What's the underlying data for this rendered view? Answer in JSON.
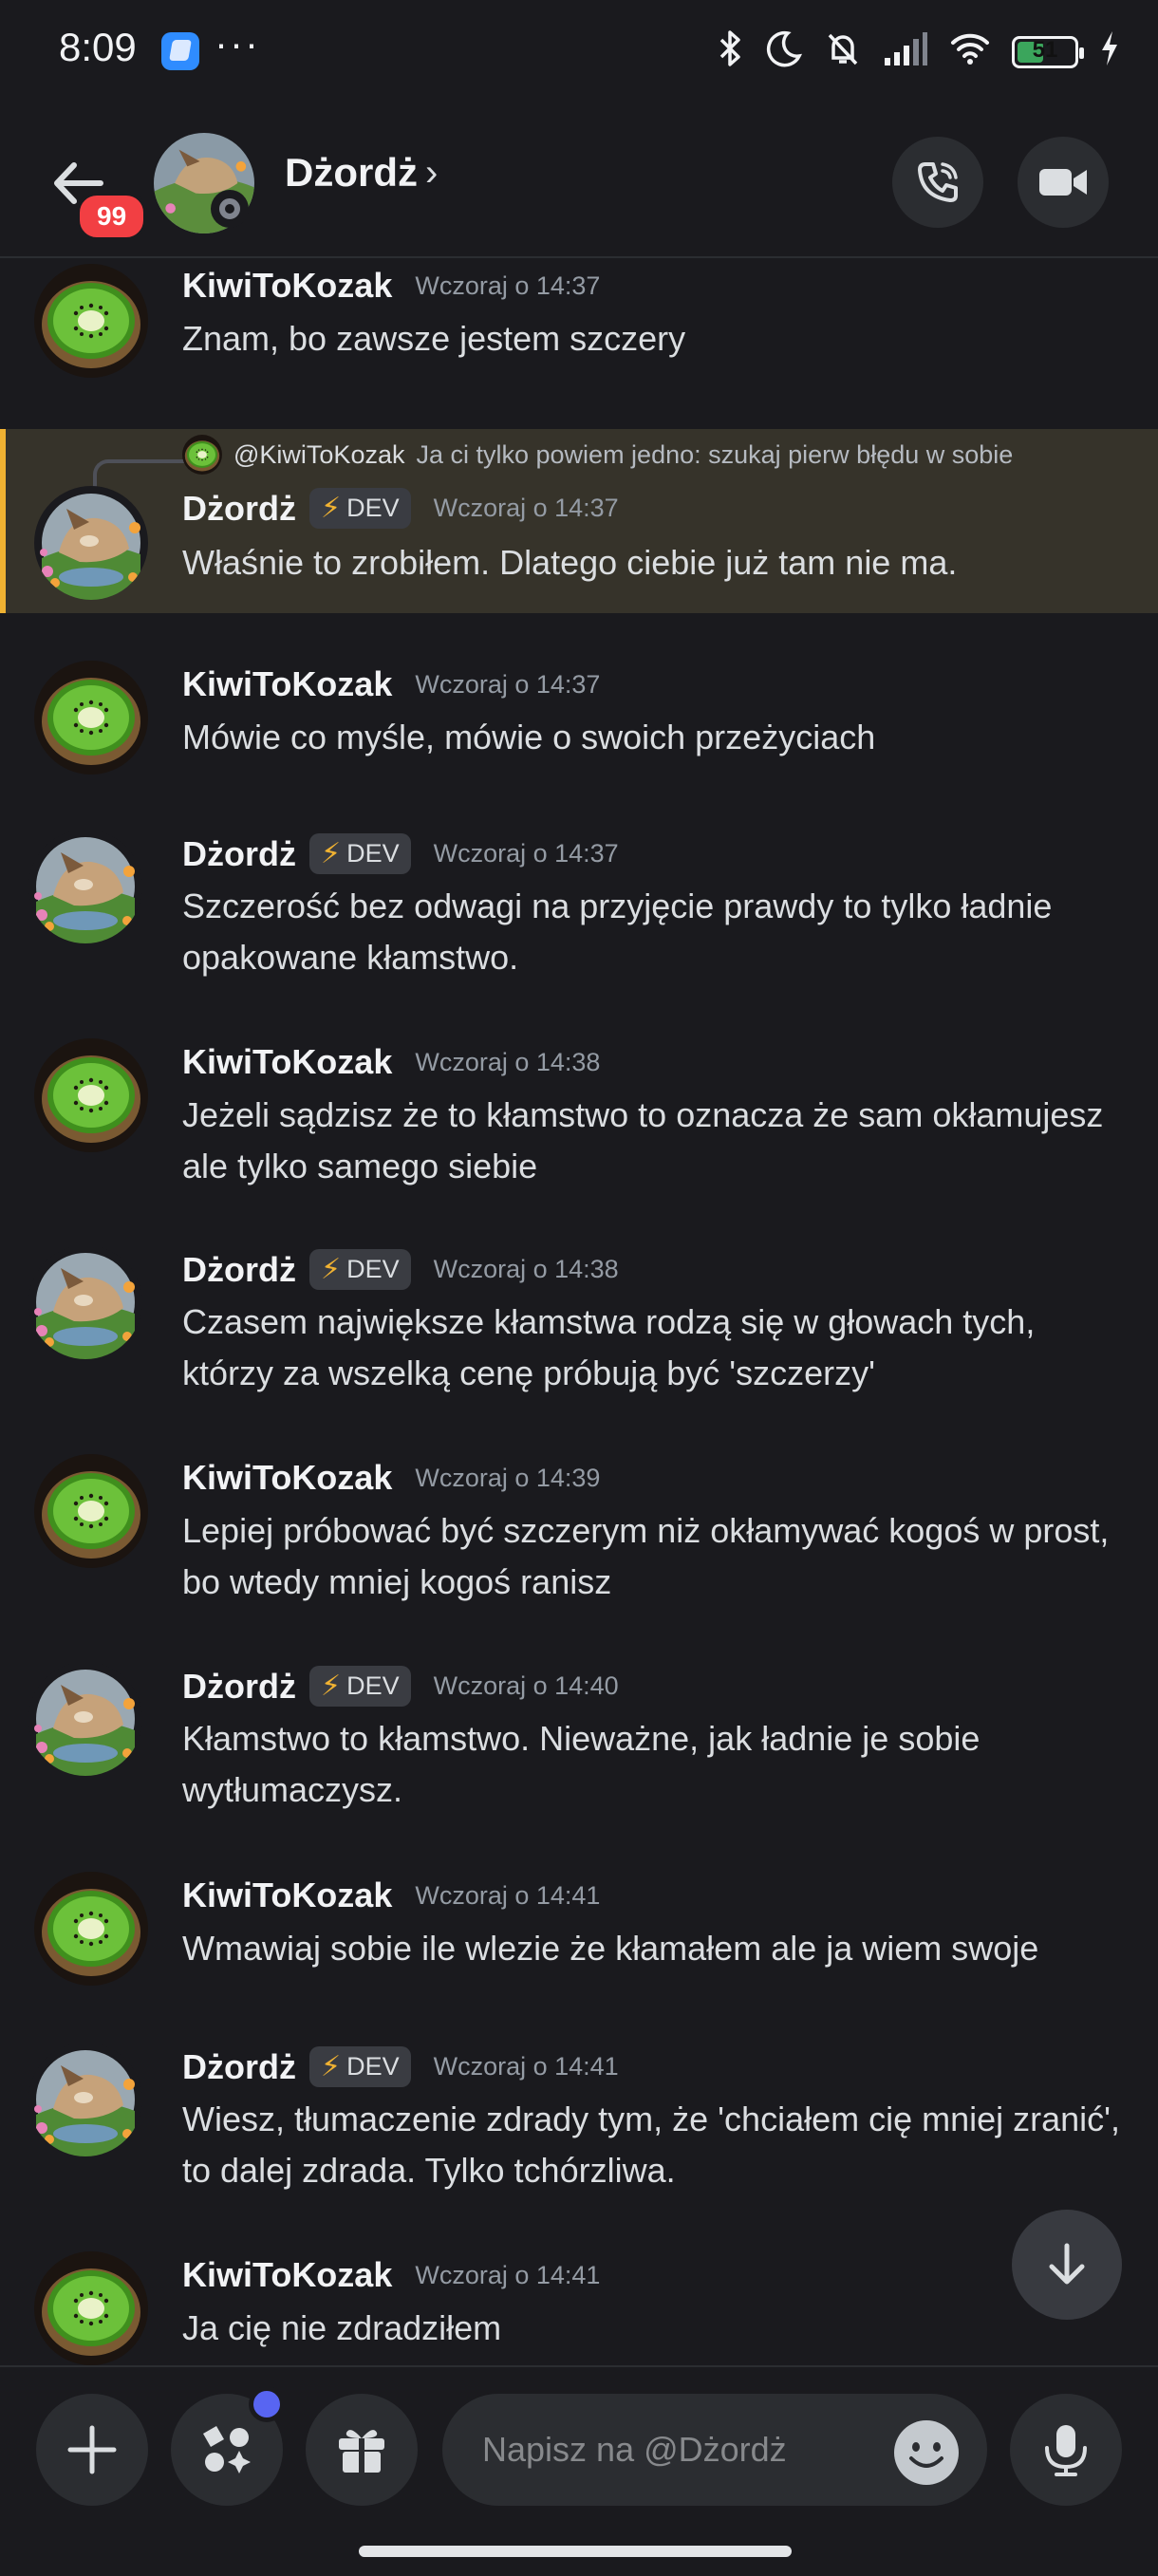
{
  "status_bar": {
    "time": "8:09",
    "more": "···",
    "battery_level": "51"
  },
  "header": {
    "unread_count": "99",
    "name": "Dżordż",
    "chevron": "›"
  },
  "messages": [
    {
      "author": "KiwiToKozak",
      "timestamp": "Wczoraj o 14:37",
      "text": "Znam, bo zawsze jestem szczery",
      "avatar": "kiwi"
    },
    {
      "author": "Dżordż",
      "tag": "DEV",
      "timestamp": "Wczoraj o 14:37",
      "text": "Właśnie to zrobiłem. Dlatego ciebie już tam nie ma.",
      "avatar": "dog",
      "reply": {
        "author": "@KiwiToKozak",
        "text": "Ja ci tylko powiem jedno: szukaj pierw błędu w sobie"
      }
    },
    {
      "author": "KiwiToKozak",
      "timestamp": "Wczoraj o 14:37",
      "text": "Mówie co myśle, mówie o swoich przeżyciach",
      "avatar": "kiwi"
    },
    {
      "author": "Dżordż",
      "tag": "DEV",
      "timestamp": "Wczoraj o 14:37",
      "text": "Szczerość bez odwagi na przyjęcie prawdy to tylko ładnie opakowane kłamstwo.",
      "avatar": "dog"
    },
    {
      "author": "KiwiToKozak",
      "timestamp": "Wczoraj o 14:38",
      "text": "Jeżeli sądzisz że to kłamstwo to oznacza że sam okłamujesz ale tylko samego siebie",
      "avatar": "kiwi"
    },
    {
      "author": "Dżordż",
      "tag": "DEV",
      "timestamp": "Wczoraj o 14:38",
      "text": "Czasem największe kłamstwa rodzą się w głowach tych, którzy za wszelką cenę próbują być 'szczerzy'",
      "avatar": "dog"
    },
    {
      "author": "KiwiToKozak",
      "timestamp": "Wczoraj o 14:39",
      "text": "Lepiej próbować być szczerym niż okłamywać kogoś w prost, bo wtedy mniej kogoś ranisz",
      "avatar": "kiwi"
    },
    {
      "author": "Dżordż",
      "tag": "DEV",
      "timestamp": "Wczoraj o 14:40",
      "text": "Kłamstwo to kłamstwo. Nieważne, jak ładnie je sobie wytłumaczysz.",
      "avatar": "dog"
    },
    {
      "author": "KiwiToKozak",
      "timestamp": "Wczoraj o 14:41",
      "text": "Wmawiaj sobie ile wlezie że kłamałem  ale ja wiem swoje",
      "avatar": "kiwi"
    },
    {
      "author": "Dżordż",
      "tag": "DEV",
      "timestamp": "Wczoraj o 14:41",
      "text": "Wiesz, tłumaczenie zdrady tym, że 'chciałem cię mniej zranić', to dalej zdrada. Tylko tchórzliwa.",
      "avatar": "dog"
    },
    {
      "author": "KiwiToKozak",
      "timestamp": "Wczoraj o 14:41",
      "text": "Ja cię nie zdradziłem",
      "avatar": "kiwi"
    }
  ],
  "composer": {
    "placeholder": "Napisz na @Dżordż"
  },
  "colors": {
    "background": "#1a1a1e",
    "highlight": "#36332a",
    "highlight_bar": "#f0b232",
    "badge": "#f23f43",
    "accent": "#5865f2"
  },
  "icons": [
    "back-arrow-icon",
    "phone-icon",
    "video-camera-icon",
    "plus-icon",
    "apps-icon",
    "gift-icon",
    "emoji-icon",
    "microphone-icon",
    "arrow-down-icon"
  ]
}
